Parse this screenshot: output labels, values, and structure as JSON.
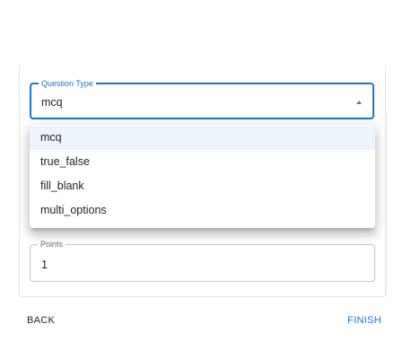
{
  "question_type": {
    "label": "Question Type",
    "value": "mcq",
    "options": [
      "mcq",
      "true_false",
      "fill_blank",
      "multi_options"
    ],
    "selected_index": 0
  },
  "points": {
    "label": "Points",
    "value": "1"
  },
  "actions": {
    "back_label": "BACK",
    "finish_label": "FINISH"
  },
  "colors": {
    "primary": "#1976d2",
    "selected_bg": "rgba(25,118,210,0.08)"
  }
}
